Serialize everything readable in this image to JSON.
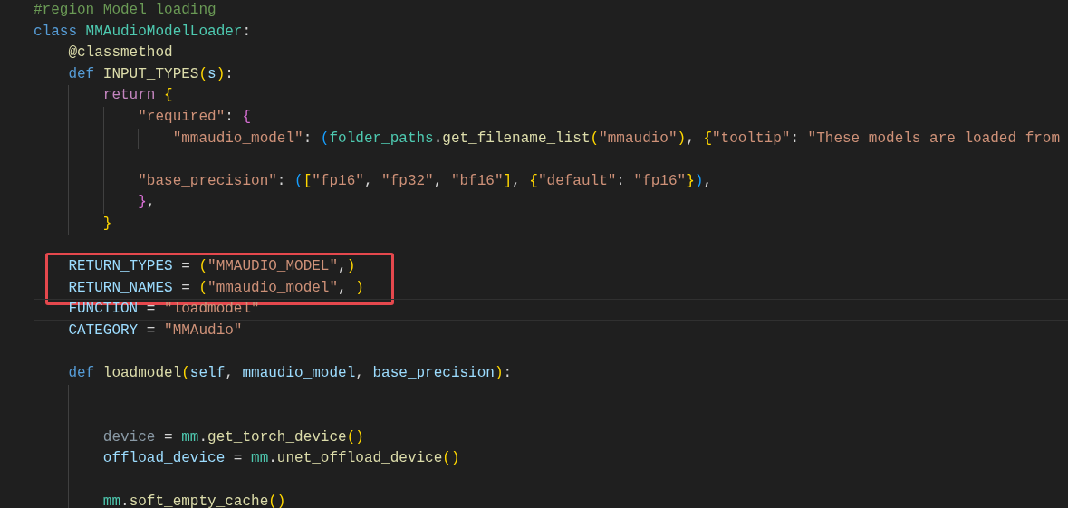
{
  "editor": {
    "lines": [
      {
        "kind": "code",
        "tokens": [
          {
            "text": "#region Model loading",
            "kind": "comment"
          }
        ]
      },
      {
        "kind": "code",
        "tokens": [
          {
            "text": "class ",
            "kind": "keyword"
          },
          {
            "text": "MMAudioModelLoader",
            "kind": "type"
          },
          {
            "text": ":",
            "kind": "plain"
          }
        ]
      },
      {
        "kind": "code",
        "tokens": [
          {
            "text": "    @classmethod",
            "kind": "function"
          }
        ]
      },
      {
        "kind": "code",
        "tokens": [
          {
            "text": "    def ",
            "kind": "keyword"
          },
          {
            "text": "INPUT_TYPES",
            "kind": "function"
          },
          {
            "text": "(",
            "kind": "bracket1"
          },
          {
            "text": "s",
            "kind": "variable"
          },
          {
            "text": ")",
            "kind": "bracket1"
          },
          {
            "text": ":",
            "kind": "plain"
          }
        ]
      },
      {
        "kind": "code",
        "tokens": [
          {
            "text": "        return",
            "kind": "control"
          },
          {
            "text": " {",
            "kind": "bracket1"
          }
        ]
      },
      {
        "kind": "code",
        "tokens": [
          {
            "text": "            \"required\"",
            "kind": "string"
          },
          {
            "text": ": ",
            "kind": "plain"
          },
          {
            "text": "{",
            "kind": "bracket2"
          }
        ]
      },
      {
        "kind": "code",
        "tokens": [
          {
            "text": "                \"mmaudio_model\"",
            "kind": "string"
          },
          {
            "text": ": ",
            "kind": "plain"
          },
          {
            "text": "(",
            "kind": "bracket3"
          },
          {
            "text": "folder_paths",
            "kind": "type"
          },
          {
            "text": ".",
            "kind": "plain"
          },
          {
            "text": "get_filename_list",
            "kind": "function"
          },
          {
            "text": "(",
            "kind": "bracket1"
          },
          {
            "text": "\"mmaudio\"",
            "kind": "string"
          },
          {
            "text": ")",
            "kind": "bracket1"
          },
          {
            "text": ", ",
            "kind": "plain"
          },
          {
            "text": "{",
            "kind": "bracket1"
          },
          {
            "text": "\"tooltip\"",
            "kind": "string"
          },
          {
            "text": ": ",
            "kind": "plain"
          },
          {
            "text": "\"These models are loaded from",
            "kind": "string"
          }
        ]
      },
      {
        "kind": "blank"
      },
      {
        "kind": "code",
        "tokens": [
          {
            "text": "            \"base_precision\"",
            "kind": "string"
          },
          {
            "text": ": ",
            "kind": "plain"
          },
          {
            "text": "(",
            "kind": "bracket3"
          },
          {
            "text": "[",
            "kind": "bracket1"
          },
          {
            "text": "\"fp16\"",
            "kind": "string"
          },
          {
            "text": ", ",
            "kind": "plain"
          },
          {
            "text": "\"fp32\"",
            "kind": "string"
          },
          {
            "text": ", ",
            "kind": "plain"
          },
          {
            "text": "\"bf16\"",
            "kind": "string"
          },
          {
            "text": "]",
            "kind": "bracket1"
          },
          {
            "text": ", ",
            "kind": "plain"
          },
          {
            "text": "{",
            "kind": "bracket1"
          },
          {
            "text": "\"default\"",
            "kind": "string"
          },
          {
            "text": ": ",
            "kind": "plain"
          },
          {
            "text": "\"fp16\"",
            "kind": "string"
          },
          {
            "text": "}",
            "kind": "bracket1"
          },
          {
            "text": ")",
            "kind": "bracket3"
          },
          {
            "text": ",",
            "kind": "plain"
          }
        ]
      },
      {
        "kind": "code",
        "tokens": [
          {
            "text": "            }",
            "kind": "bracket2"
          },
          {
            "text": ",",
            "kind": "plain"
          }
        ]
      },
      {
        "kind": "code",
        "tokens": [
          {
            "text": "        }",
            "kind": "bracket1"
          }
        ]
      },
      {
        "kind": "blank"
      },
      {
        "kind": "code",
        "boxed": true,
        "tokens": [
          {
            "text": "    RETURN_TYPES",
            "kind": "variable"
          },
          {
            "text": " = ",
            "kind": "plain"
          },
          {
            "text": "(",
            "kind": "bracket1"
          },
          {
            "text": "\"MMAUDIO_MODEL\"",
            "kind": "string"
          },
          {
            "text": ",",
            "kind": "plain"
          },
          {
            "text": ")",
            "kind": "bracket1"
          }
        ]
      },
      {
        "kind": "code",
        "boxed": true,
        "tokens": [
          {
            "text": "    RETURN_NAMES",
            "kind": "variable"
          },
          {
            "text": " = ",
            "kind": "plain"
          },
          {
            "text": "(",
            "kind": "bracket1"
          },
          {
            "text": "\"mmaudio_model\"",
            "kind": "string"
          },
          {
            "text": ", ",
            "kind": "plain"
          },
          {
            "text": ")",
            "kind": "bracket1"
          }
        ]
      },
      {
        "kind": "code",
        "current": true,
        "tokens": [
          {
            "text": "    FUNCTION",
            "kind": "variable"
          },
          {
            "text": " = ",
            "kind": "plain"
          },
          {
            "text": "\"loadmodel\"",
            "kind": "string"
          }
        ]
      },
      {
        "kind": "code",
        "tokens": [
          {
            "text": "    CATEGORY",
            "kind": "variable"
          },
          {
            "text": " = ",
            "kind": "plain"
          },
          {
            "text": "\"MMAudio\"",
            "kind": "string"
          }
        ]
      },
      {
        "kind": "blank"
      },
      {
        "kind": "code",
        "tokens": [
          {
            "text": "    def ",
            "kind": "keyword"
          },
          {
            "text": "loadmodel",
            "kind": "function"
          },
          {
            "text": "(",
            "kind": "bracket1"
          },
          {
            "text": "self",
            "kind": "variable"
          },
          {
            "text": ", ",
            "kind": "plain"
          },
          {
            "text": "mmaudio_model",
            "kind": "variable"
          },
          {
            "text": ", ",
            "kind": "plain"
          },
          {
            "text": "base_precision",
            "kind": "variable"
          },
          {
            "text": ")",
            "kind": "bracket1"
          },
          {
            "text": ":",
            "kind": "plain"
          }
        ]
      },
      {
        "kind": "blank"
      },
      {
        "kind": "blank"
      },
      {
        "kind": "code",
        "tokens": [
          {
            "text": "        device",
            "kind": "unused"
          },
          {
            "text": " = ",
            "kind": "plain"
          },
          {
            "text": "mm",
            "kind": "type"
          },
          {
            "text": ".",
            "kind": "plain"
          },
          {
            "text": "get_torch_device",
            "kind": "function"
          },
          {
            "text": "()",
            "kind": "bracket1"
          }
        ]
      },
      {
        "kind": "code",
        "tokens": [
          {
            "text": "        offload_device",
            "kind": "variable"
          },
          {
            "text": " = ",
            "kind": "plain"
          },
          {
            "text": "mm",
            "kind": "type"
          },
          {
            "text": ".",
            "kind": "plain"
          },
          {
            "text": "unet_offload_device",
            "kind": "function"
          },
          {
            "text": "()",
            "kind": "bracket1"
          }
        ]
      },
      {
        "kind": "blank"
      },
      {
        "kind": "code",
        "tokens": [
          {
            "text": "        mm",
            "kind": "type"
          },
          {
            "text": ".",
            "kind": "plain"
          },
          {
            "text": "soft_empty_cache",
            "kind": "function"
          },
          {
            "text": "()",
            "kind": "bracket1"
          }
        ]
      }
    ]
  }
}
